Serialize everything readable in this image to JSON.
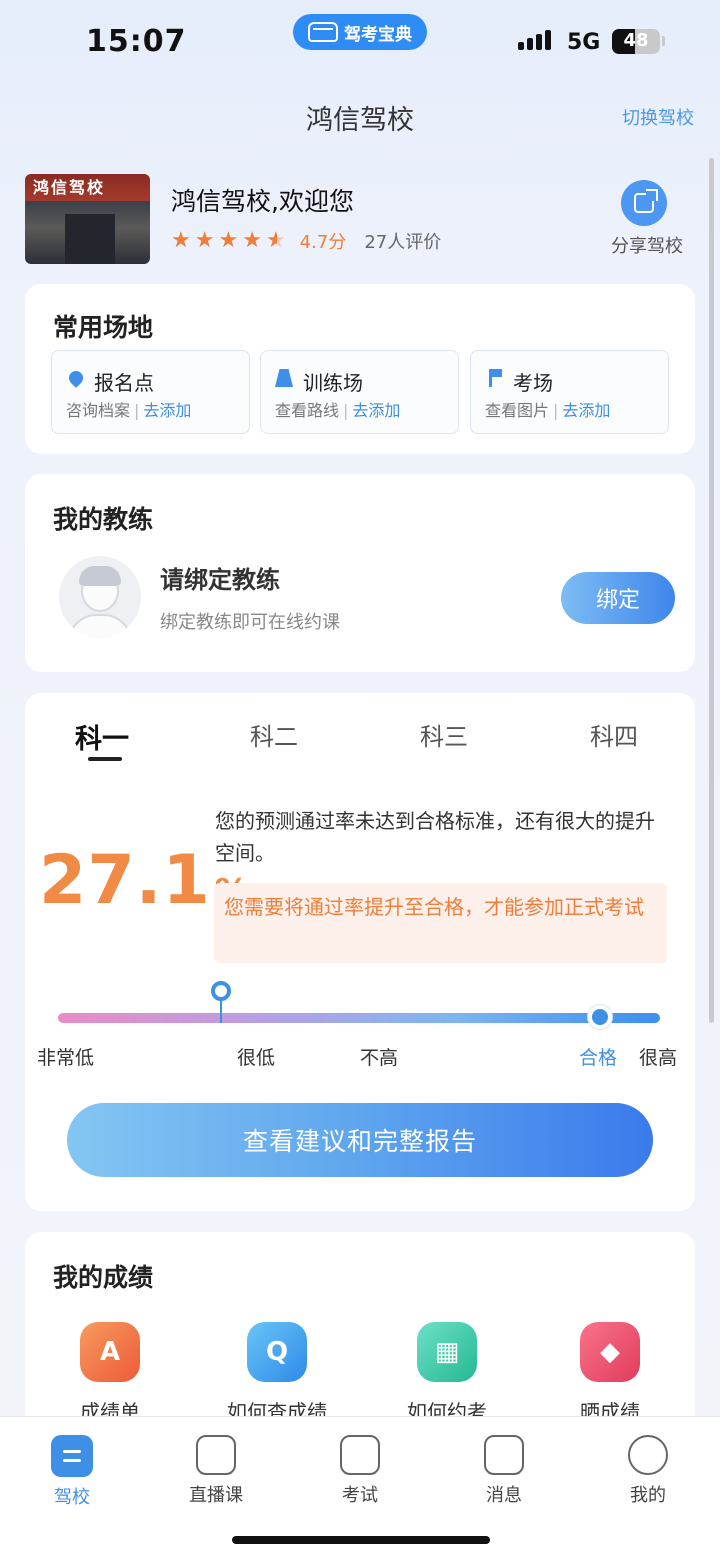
{
  "status_bar": {
    "time": "15:07",
    "app_name": "驾考宝典",
    "network": "5G",
    "battery": "48"
  },
  "header": {
    "title": "鸿信驾校",
    "switch_label": "切换驾校"
  },
  "school": {
    "photo_sign": "鸿信驾校",
    "welcome": "鸿信驾校,欢迎您",
    "stars": 4.5,
    "rating": "4.7分",
    "reviews": "27人评价",
    "share_label": "分享驾校"
  },
  "venues": {
    "title": "常用场地",
    "items": [
      {
        "name": "报名点",
        "sub": "咨询档案",
        "action": "去添加",
        "icon": "location-pin-icon"
      },
      {
        "name": "训练场",
        "sub": "查看路线",
        "action": "去添加",
        "icon": "road-icon"
      },
      {
        "name": "考场",
        "sub": "查看图片",
        "action": "去添加",
        "icon": "flag-icon"
      }
    ]
  },
  "coach": {
    "title": "我的教练",
    "bind_title": "请绑定教练",
    "bind_sub": "绑定教练即可在线约课",
    "bind_button": "绑定"
  },
  "exam": {
    "tabs": [
      "科一",
      "科二",
      "科三",
      "科四"
    ],
    "active_tab": 0,
    "pass_rate": "27.1",
    "pass_rate_unit": "%",
    "prediction_text": "您的预测通过率未达到合格标准，还有很大的提升空间。",
    "warning_text": "您需要将通过率提升至合格，才能参加正式考试",
    "scale_labels": [
      "非常低",
      "很低",
      "不高",
      "合格",
      "很高"
    ],
    "report_button": "查看建议和完整报告"
  },
  "scores": {
    "title": "我的成绩",
    "items": [
      {
        "label": "成绩单",
        "icon": "report-card-icon",
        "color": "#f0643f"
      },
      {
        "label": "如何查成绩",
        "icon": "search-icon",
        "color": "#3b9cf0"
      },
      {
        "label": "如何约考",
        "icon": "calendar-clock-icon",
        "color": "#33c4a7"
      },
      {
        "label": "晒成绩",
        "icon": "tag-icon",
        "color": "#ee4c6a"
      }
    ]
  },
  "tab_bar": {
    "items": [
      {
        "label": "驾校",
        "icon": "school-icon",
        "active": true
      },
      {
        "label": "直播课",
        "icon": "live-tv-icon",
        "active": false
      },
      {
        "label": "考试",
        "icon": "exam-icon",
        "active": false
      },
      {
        "label": "消息",
        "icon": "message-icon",
        "active": false
      },
      {
        "label": "我的",
        "icon": "profile-icon",
        "active": false
      }
    ]
  },
  "colors": {
    "accent": "#3e8fe6",
    "orange": "#f07e3a"
  }
}
